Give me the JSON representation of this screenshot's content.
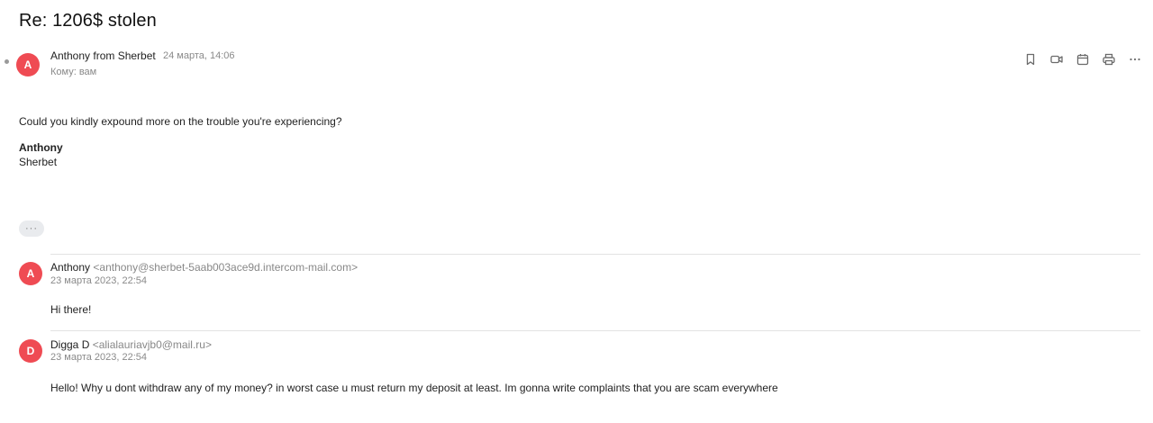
{
  "subject": "Re: 1206$ stolen",
  "toolbar": {
    "icons": [
      "bookmark-icon",
      "video-icon",
      "calendar-icon",
      "print-icon",
      "more-icon"
    ]
  },
  "main_message": {
    "avatar_letter": "A",
    "sender": "Anthony from Sherbet",
    "date": "24 марта, 14:06",
    "to": "Кому: вам",
    "body": "Could you kindly expound more on the trouble you're experiencing?",
    "signature_name": "Anthony",
    "signature_company": "Sherbet"
  },
  "expand_button": "···",
  "quoted": [
    {
      "avatar_letter": "A",
      "avatar_color": "#ef4b53",
      "sender": "Anthony",
      "email": "<anthony@sherbet-5aab003ace9d.intercom-mail.com>",
      "date": "23 марта 2023, 22:54",
      "body": "Hi there!"
    },
    {
      "avatar_letter": "D",
      "avatar_color": "#ef4b53",
      "sender": "Digga D",
      "email": "<alialauriavjb0@mail.ru>",
      "date": "23 марта 2023, 22:54",
      "body": "Hello! Why u dont withdraw any of my money? in worst case u must return my deposit at least. Im gonna write complaints that you are scam everywhere"
    }
  ]
}
